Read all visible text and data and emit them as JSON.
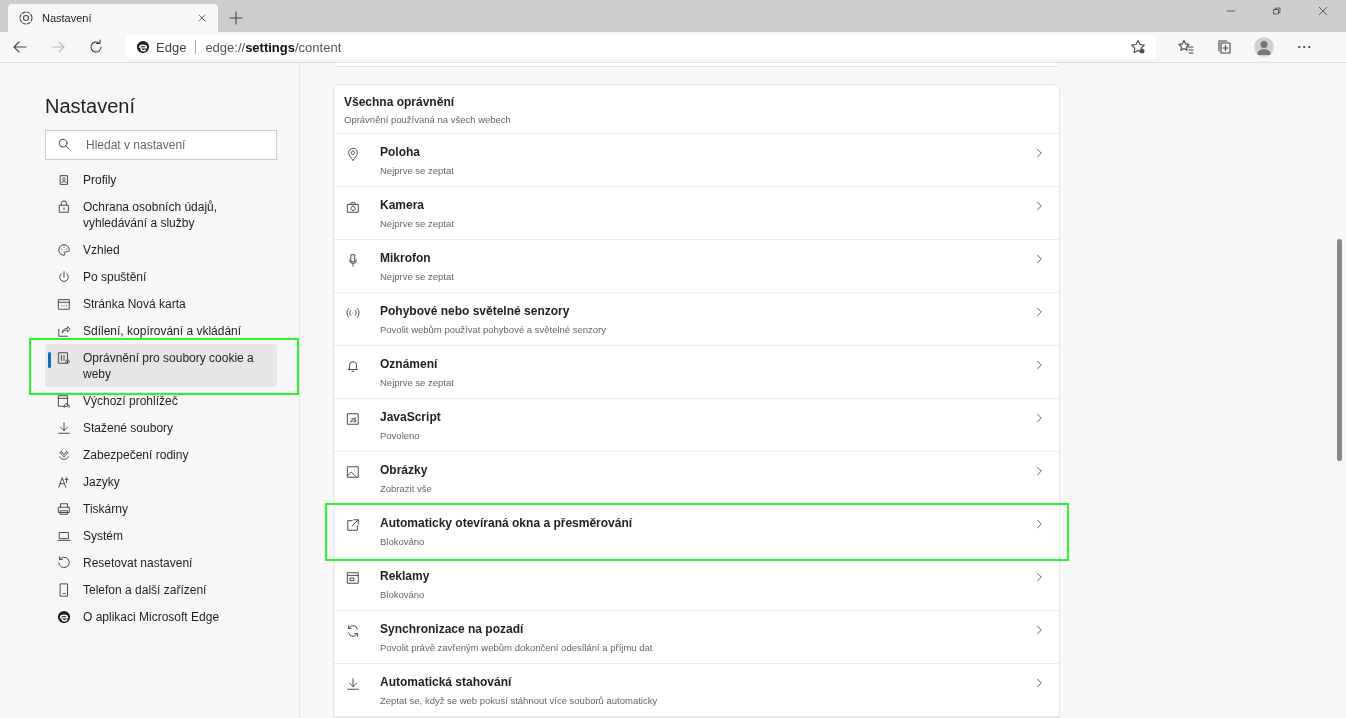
{
  "tab": {
    "title": "Nastavení"
  },
  "address_bar": {
    "site": "Edge",
    "url_prefix": "edge://",
    "url_bold": "settings",
    "url_suffix": "/content"
  },
  "sidebar": {
    "title": "Nastavení",
    "search": {
      "placeholder": "Hledat v nastavení"
    },
    "items": [
      {
        "label": "Profily",
        "selected": false,
        "highlighted": false
      },
      {
        "label": "Ochrana osobních údajů, vyhledávání a služby",
        "selected": false,
        "highlighted": false
      },
      {
        "label": "Vzhled",
        "selected": false,
        "highlighted": false
      },
      {
        "label": "Po spuštění",
        "selected": false,
        "highlighted": false
      },
      {
        "label": "Stránka Nová karta",
        "selected": false,
        "highlighted": false
      },
      {
        "label": "Sdílení, kopírování a vkládání",
        "selected": false,
        "highlighted": false
      },
      {
        "label": "Oprávnění pro soubory cookie a weby",
        "selected": true,
        "highlighted": true
      },
      {
        "label": "Výchozí prohlížeč",
        "selected": false,
        "highlighted": false
      },
      {
        "label": "Stažené soubory",
        "selected": false,
        "highlighted": false
      },
      {
        "label": "Zabezpečení rodiny",
        "selected": false,
        "highlighted": false
      },
      {
        "label": "Jazyky",
        "selected": false,
        "highlighted": false
      },
      {
        "label": "Tiskárny",
        "selected": false,
        "highlighted": false
      },
      {
        "label": "Systém",
        "selected": false,
        "highlighted": false
      },
      {
        "label": "Resetovat nastavení",
        "selected": false,
        "highlighted": false
      },
      {
        "label": "Telefon a další zařízení",
        "selected": false,
        "highlighted": false
      },
      {
        "label": "O aplikaci Microsoft Edge",
        "selected": false,
        "highlighted": false
      }
    ]
  },
  "permissions": {
    "title": "Všechna oprávnění",
    "subtitle": "Oprávnění používaná na všech webech",
    "rows": [
      {
        "title": "Poloha",
        "status": "Nejprve se zeptat",
        "highlighted": false
      },
      {
        "title": "Kamera",
        "status": "Nejprve se zeptat",
        "highlighted": false
      },
      {
        "title": "Mikrofon",
        "status": "Nejprve se zeptat",
        "highlighted": false
      },
      {
        "title": "Pohybové nebo světelné senzory",
        "status": "Povolit webům používat pohybové a světelné senzory",
        "highlighted": false
      },
      {
        "title": "Oznámení",
        "status": "Nejprve se zeptat",
        "highlighted": false
      },
      {
        "title": "JavaScript",
        "status": "Povoleno",
        "highlighted": false
      },
      {
        "title": "Obrázky",
        "status": "Zobrazit vše",
        "highlighted": false
      },
      {
        "title": "Automaticky otevíraná okna a přesměrování",
        "status": "Blokováno",
        "highlighted": true
      },
      {
        "title": "Reklamy",
        "status": "Blokováno",
        "highlighted": false
      },
      {
        "title": "Synchronizace na pozadí",
        "status": "Povolit právě zavřeným webům dokončení odesílání a příjmu dat",
        "highlighted": false
      },
      {
        "title": "Automatická stahování",
        "status": "Zeptat se, když se web pokusí stáhnout více souborů automaticky",
        "highlighted": false
      }
    ]
  }
}
